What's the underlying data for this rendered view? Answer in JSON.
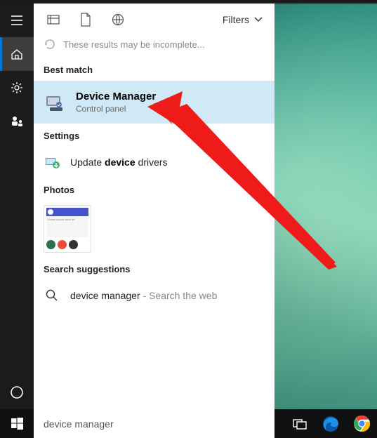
{
  "header": {
    "filters_label": "Filters",
    "incomplete_msg": "These results may be incomplete..."
  },
  "sections": {
    "best_match": "Best match",
    "settings": "Settings",
    "photos": "Photos",
    "suggestions": "Search suggestions"
  },
  "best_match_result": {
    "title": "Device Manager",
    "subtitle": "Control panel"
  },
  "settings_result": {
    "prefix": "Update ",
    "bold": "device",
    "suffix": " drivers"
  },
  "suggestion": {
    "term": "device manager",
    "hint": " - Search the web"
  },
  "search_query": "device manager",
  "colors": {
    "highlight": "#cfeaf6",
    "accent": "#0078d7"
  }
}
